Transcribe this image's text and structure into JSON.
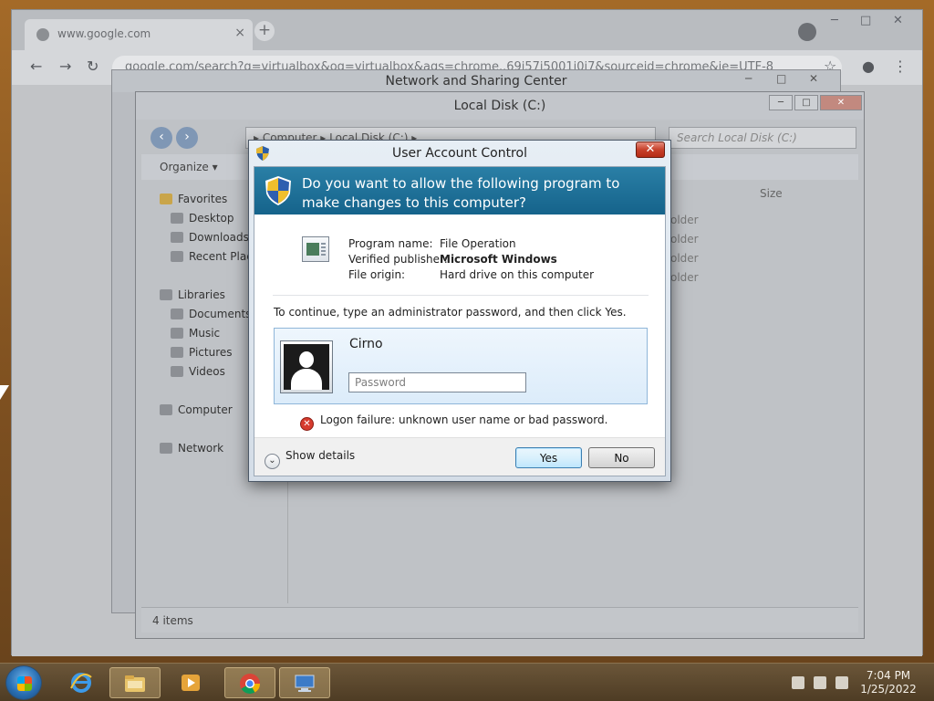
{
  "browser": {
    "tab_title": "www.google.com",
    "tab_close": "×",
    "new_tab": "+",
    "omnibox": "google.com/search?q=virtualbox&oq=virtualbox&aqs=chrome..69i57j5001j0j7&sourceid=chrome&ie=UTF-8",
    "back": "←",
    "forward": "→",
    "reload": "↻",
    "minimize": "─",
    "maximize": "□",
    "close": "✕",
    "star": "☆",
    "profile": "●",
    "menu": "⋮"
  },
  "network_center": {
    "title": "Network and Sharing Center",
    "minimize": "─",
    "maximize": "□",
    "close": "✕"
  },
  "explorer": {
    "title": "Local Disk (C:)",
    "minimize": "─",
    "maximize": "□",
    "close": "✕",
    "address": "▸ Computer ▸ Local Disk (C:) ▸",
    "search_placeholder": "Search Local Disk (C:)",
    "organize": "Organize ▾",
    "column_size": "Size",
    "nav": {
      "favorites": "Favorites",
      "desktop": "Desktop",
      "downloads": "Downloads",
      "recent": "Recent Places",
      "libraries": "Libraries",
      "documents": "Documents",
      "music": "Music",
      "pictures": "Pictures",
      "videos": "Videos",
      "computer": "Computer",
      "network": "Network"
    },
    "folder_type": "older",
    "status": "4 items"
  },
  "uac": {
    "title": "User Account Control",
    "close": "✕",
    "question": "Do you want to allow the following program to make changes to this computer?",
    "labels": {
      "program_name": "Program name:",
      "publisher": "Verified publisher:",
      "origin": "File origin:"
    },
    "values": {
      "program_name": "File Operation",
      "publisher": "Microsoft Windows",
      "origin": "Hard drive on this computer"
    },
    "prompt": "To continue, type an administrator password, and then click Yes.",
    "username": "Cirno",
    "password_placeholder": "Password",
    "error_icon": "✕",
    "error": "Logon failure: unknown user name or bad password.",
    "show_details_icon": "⌄",
    "show_details": "Show details",
    "yes": "Yes",
    "no": "No"
  },
  "taskbar": {
    "time": "7:04 PM",
    "date": "1/25/2022"
  },
  "colors": {
    "uac_banner": "#15638b",
    "error_red": "#d63b2e",
    "taskbar": "#4e3c24"
  }
}
